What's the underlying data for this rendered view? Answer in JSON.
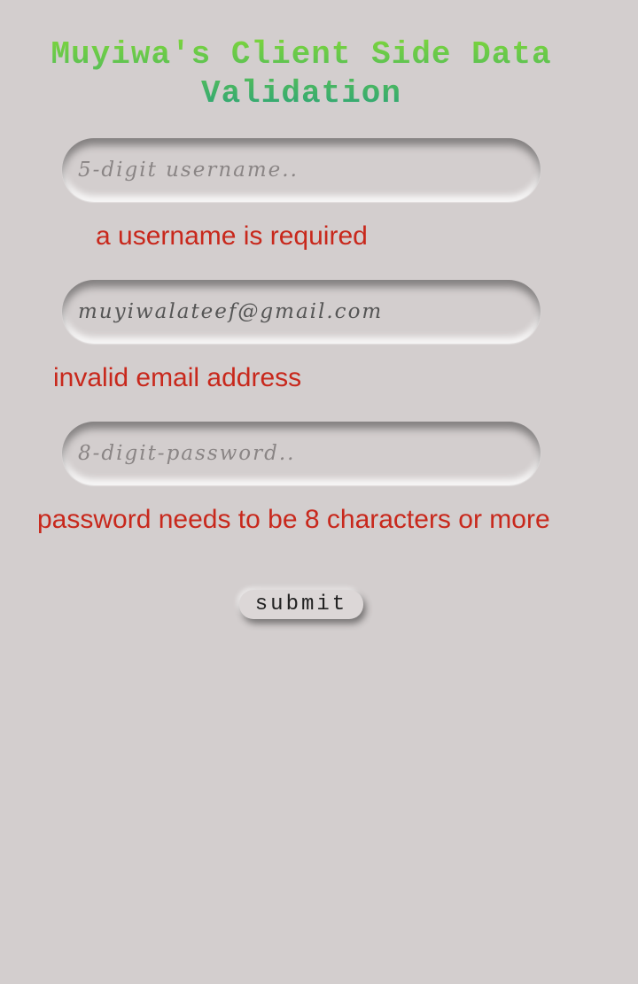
{
  "page": {
    "title": "Muyiwa's Client Side Data Validation",
    "title_gradient": [
      "#7ed63a",
      "#2aa37a"
    ],
    "background": "#d3cece"
  },
  "form": {
    "username": {
      "placeholder": "5-digit username..",
      "value": "",
      "error": "a username is required"
    },
    "email": {
      "placeholder": "",
      "value": "muyiwalateef@gmail.com",
      "error": "invalid email address"
    },
    "password": {
      "placeholder": "8-digit-password..",
      "value": "",
      "error": "password needs to be 8 characters or more"
    },
    "submit_label": "submit",
    "error_color": "#c8281c"
  }
}
